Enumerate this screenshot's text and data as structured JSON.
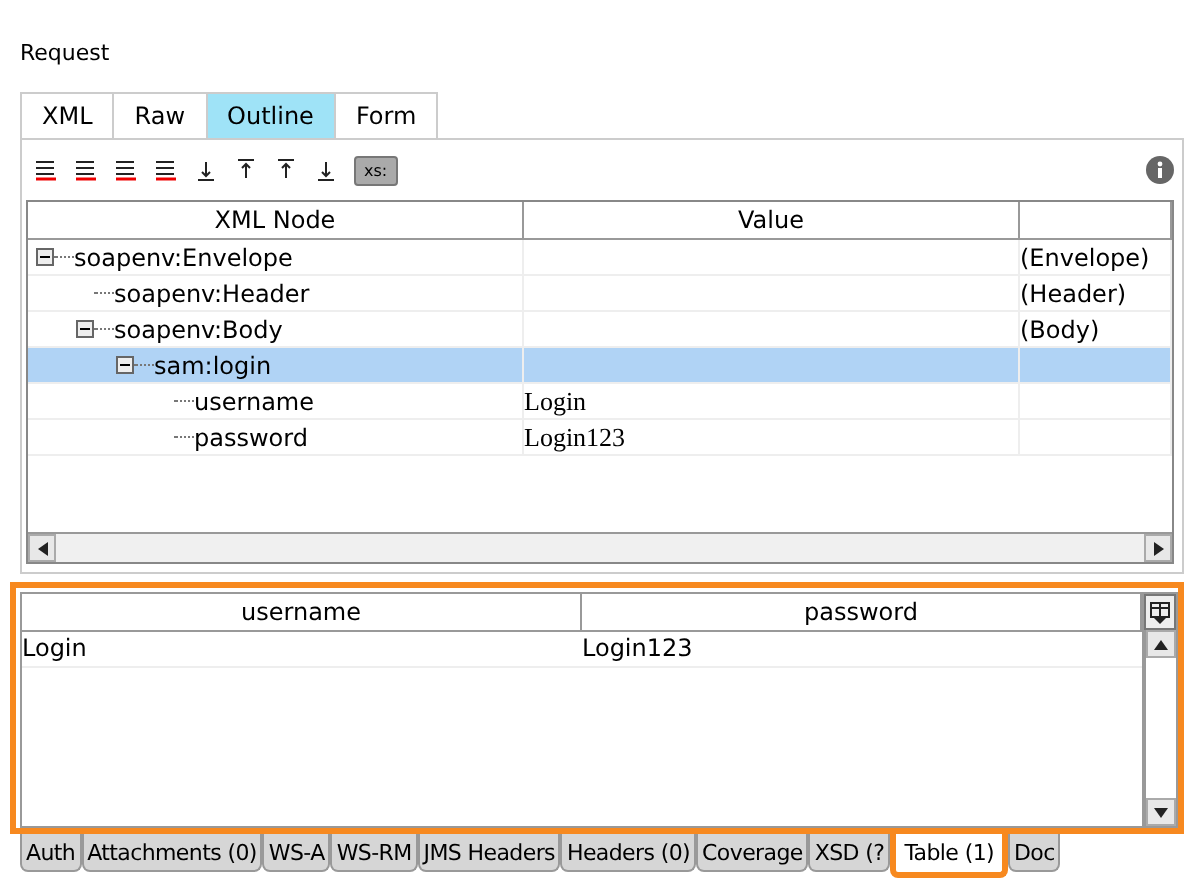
{
  "title": "Request",
  "editor_tabs": [
    {
      "label": "XML",
      "selected": false
    },
    {
      "label": "Raw",
      "selected": false
    },
    {
      "label": "Outline",
      "selected": true
    },
    {
      "label": "Form",
      "selected": false
    }
  ],
  "toolbar": {
    "xsi_button": "xs:"
  },
  "tree": {
    "columns": [
      "XML Node",
      "Value"
    ],
    "nodes": [
      {
        "name": "soapenv:Envelope",
        "type": "(Envelope)",
        "selected": false,
        "expanded": true,
        "children": [
          {
            "name": "soapenv:Header",
            "type": "(Header)",
            "selected": false
          },
          {
            "name": "soapenv:Body",
            "type": "(Body)",
            "selected": false,
            "expanded": true,
            "children": [
              {
                "name": "sam:login",
                "selected": true,
                "expanded": true,
                "children": [
                  {
                    "name": "username",
                    "value": "Login",
                    "selected": false
                  },
                  {
                    "name": "password",
                    "value": "Login123",
                    "selected": false
                  }
                ]
              }
            ]
          }
        ]
      }
    ]
  },
  "table": {
    "columns": [
      "username",
      "password"
    ],
    "rows": [
      [
        "Login",
        "Login123"
      ]
    ]
  },
  "bottom_tabs": [
    {
      "label": "Auth",
      "selected": false
    },
    {
      "label": "Attachments (0)",
      "selected": false
    },
    {
      "label": "WS-A",
      "selected": false
    },
    {
      "label": "WS-RM",
      "selected": false
    },
    {
      "label": "JMS Headers",
      "selected": false
    },
    {
      "label": "Headers (0)",
      "selected": false
    },
    {
      "label": "Coverage",
      "selected": false
    },
    {
      "label": "XSD (?",
      "selected": false
    },
    {
      "label": "Table (1)",
      "selected": true
    },
    {
      "label": "Doc",
      "selected": false
    }
  ]
}
